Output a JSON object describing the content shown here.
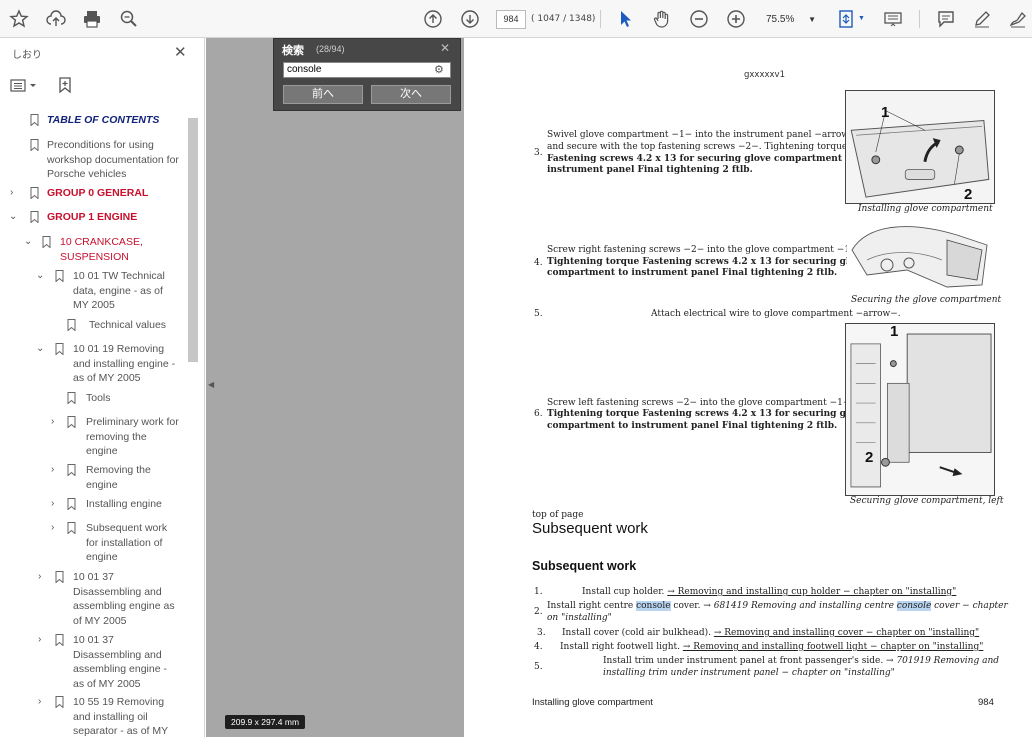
{
  "toolbar": {
    "page_current": "984",
    "page_count": "( 1047 / 1348)",
    "zoom": "75.5%"
  },
  "sidebar": {
    "title": "しおり",
    "items": [
      {
        "label": "TABLE OF CONTENTS",
        "style": "navy"
      },
      {
        "label": "Preconditions for using workshop documentation for Porsche vehicles",
        "style": "normal"
      },
      {
        "label": "GROUP 0 GENERAL",
        "style": "red"
      },
      {
        "label": "GROUP 1 ENGINE",
        "style": "red"
      },
      {
        "label": "10 CRANKCASE, SUSPENSION",
        "style": "red2"
      },
      {
        "label": "10 01 TW Technical data, engine - as of MY 2005",
        "style": "normal"
      },
      {
        "label": "Technical values",
        "style": "normal"
      },
      {
        "label": "10 01 19 Removing and installing engine - as of MY 2005",
        "style": "normal"
      },
      {
        "label": "Tools",
        "style": "normal"
      },
      {
        "label": "Preliminary work for removing the engine",
        "style": "normal"
      },
      {
        "label": "Removing the engine",
        "style": "normal"
      },
      {
        "label": "Installing engine",
        "style": "normal"
      },
      {
        "label": "Subsequent work for installation of engine",
        "style": "normal"
      },
      {
        "label": "10 01 37 Disassembling and assembling engine as of MY 2005",
        "style": "normal"
      },
      {
        "label": "10 01 37 Disassembling and assembling engine - as of MY 2005",
        "style": "normal"
      },
      {
        "label": "10 55 19 Removing and installing oil separator - as of MY",
        "style": "normal"
      }
    ]
  },
  "search": {
    "title": "検索",
    "count": "(28/94)",
    "query": "console",
    "prev_label": "前へ",
    "next_label": "次へ"
  },
  "document": {
    "header_code": "gxxxxxv1",
    "steps_top": [
      {
        "num": "3.",
        "lines": [
          "Swivel glove compartment −1− into the instrument panel −arrow−",
          "and secure with the top fastening screws −2−. Tightening torque",
          "Fastening screws 4.2 x 13 for securing glove compartment to",
          "instrument panel Final tightening 2 ftlb."
        ]
      },
      {
        "num": "4.",
        "lines": [
          "Screw right fastening screws −2− into the glove compartment −1−.",
          "Tightening torque Fastening screws 4.2 x 13 for securing glove",
          "compartment to instrument panel Final tightening 2 ftlb."
        ]
      },
      {
        "num": "5.",
        "lines": [
          "Attach electrical wire to glove compartment −arrow−."
        ]
      },
      {
        "num": "6.",
        "lines": [
          "Screw left fastening screws −2− into the glove compartment −1−.",
          "Tightening torque Fastening screws 4.2 x 13 for securing glove",
          "compartment to instrument panel Final tightening 2 ftlb."
        ]
      }
    ],
    "captions": [
      "Installing glove compartment",
      "Securing the glove compartment",
      "Securing glove compartment, left"
    ],
    "fig_labels": [
      "1",
      "2",
      "1",
      "2"
    ],
    "top_of_page": "top of page",
    "heading1": "Subsequent work",
    "heading2": "Subsequent work",
    "sub_steps": [
      {
        "num": "1.",
        "plain": "Install cup holder. ",
        "link": "&rarr; Removing and installing cup holder − chapter on \"installing\""
      },
      {
        "num": "2.",
        "plain_a": "Install right centre ",
        "hl1": "console",
        "plain_b": " cover. ",
        "italic": "&rarr; 681419 Removing and installing centre ",
        "hl2": "console",
        "italic2": " cover − chapter",
        "line2": "on \"installing\""
      },
      {
        "num": "3.",
        "plain": "Install cover (cold air bulkhead). ",
        "link": "&rarr; Removing and installing cover − chapter on \"installing\""
      },
      {
        "num": "4.",
        "plain": "Install right footwell light. ",
        "link": "&rarr; Removing and installing footwell light − chapter on \"installing\""
      },
      {
        "num": "5.",
        "plain": "Install trim under instrument panel at front passenger's side. ",
        "italic": "&rarr; 701919 Removing and",
        "line2": "installing trim under instrument panel − chapter on \"installing\""
      }
    ],
    "footer_title": "Installing glove compartment",
    "footer_page": "984"
  },
  "status": {
    "dimensions": "209.9 x 297.4 mm"
  }
}
